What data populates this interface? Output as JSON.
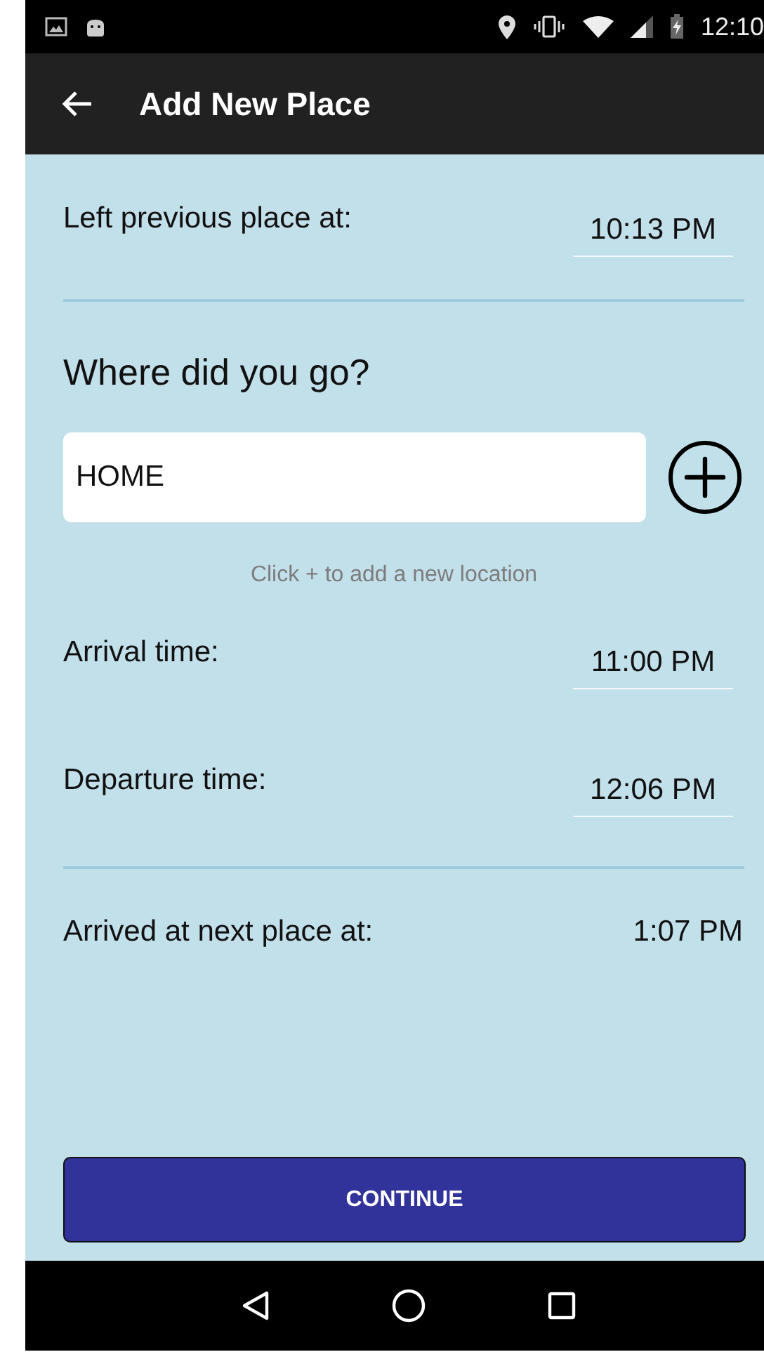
{
  "status_bar": {
    "time": "12:10"
  },
  "app_bar": {
    "title": "Add New Place"
  },
  "left_previous": {
    "label": "Left previous place at:",
    "value": "10:13 PM"
  },
  "question": "Where did you go?",
  "location_field": {
    "value": "HOME"
  },
  "hint": "Click + to add a new location",
  "times": [
    {
      "label": "Arrival time:",
      "value": "11:00 PM"
    },
    {
      "label": "Departure time:",
      "value": "12:06 PM"
    }
  ],
  "next_place": {
    "label": "Arrived at next place at:",
    "value": "1:07 PM"
  },
  "continue_button": "CONTINUE"
}
